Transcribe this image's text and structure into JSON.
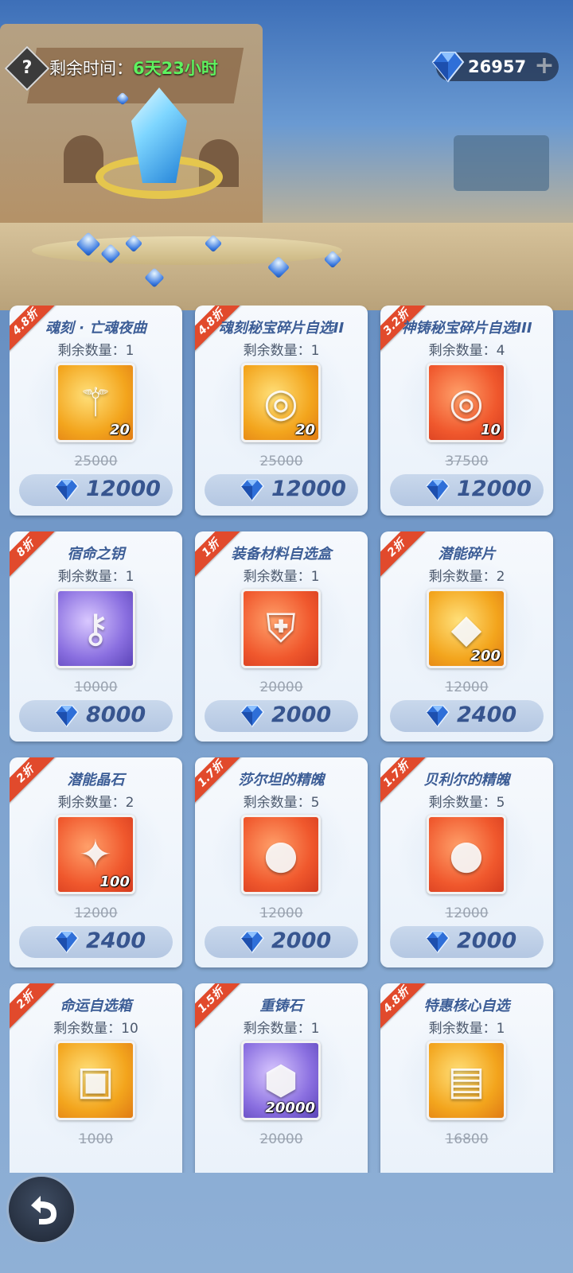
{
  "header": {
    "help_symbol": "?",
    "time_label": "剩余时间：",
    "time_value": "6天23小时",
    "currency_amount": "26957",
    "currency_plus": "+",
    "currency_icon": "diamond-icon"
  },
  "items": [
    {
      "discount": "4.8折",
      "name": "魂刻 · 亡魂夜曲",
      "remaining": "剩余数量：1",
      "icon": "scepter-icon",
      "quality": "orange",
      "count": "20",
      "original": "25000",
      "price": "12000"
    },
    {
      "discount": "4.8折",
      "name": "魂刻秘宝碎片自选II",
      "remaining": "剩余数量：1",
      "icon": "treasure-pedestal-icon",
      "quality": "orange",
      "count": "20",
      "original": "25000",
      "price": "12000"
    },
    {
      "discount": "3.2折",
      "name": "神铸秘宝碎片自选III",
      "remaining": "剩余数量：4",
      "icon": "treasure-pedestal-icon",
      "quality": "red",
      "count": "10",
      "original": "37500",
      "price": "12000"
    },
    {
      "discount": "8折",
      "name": "宿命之钥",
      "remaining": "剩余数量：1",
      "icon": "key-icon",
      "quality": "purple",
      "count": "",
      "original": "10000",
      "price": "8000"
    },
    {
      "discount": "1折",
      "name": "装备材料自选盒",
      "remaining": "剩余数量：1",
      "icon": "armor-icon",
      "quality": "red",
      "count": "",
      "original": "20000",
      "price": "2000"
    },
    {
      "discount": "2折",
      "name": "潜能碎片",
      "remaining": "剩余数量：2",
      "icon": "crystal-shard-icon",
      "quality": "orange",
      "count": "200",
      "original": "12000",
      "price": "2400"
    },
    {
      "discount": "2折",
      "name": "潜能晶石",
      "remaining": "剩余数量：2",
      "icon": "star-crystal-icon",
      "quality": "red",
      "count": "100",
      "original": "12000",
      "price": "2400"
    },
    {
      "discount": "1.7折",
      "name": "莎尔坦的精魄",
      "remaining": "剩余数量：5",
      "icon": "dark-orb-icon",
      "quality": "red",
      "count": "",
      "original": "12000",
      "price": "2000"
    },
    {
      "discount": "1.7折",
      "name": "贝利尔的精魄",
      "remaining": "剩余数量：5",
      "icon": "red-orb-icon",
      "quality": "red",
      "count": "",
      "original": "12000",
      "price": "2000"
    },
    {
      "discount": "2折",
      "name": "命运自选箱",
      "remaining": "剩余数量：10",
      "icon": "chest-icon",
      "quality": "orange",
      "count": "",
      "original": "1000",
      "price": ""
    },
    {
      "discount": "1.5折",
      "name": "重铸石",
      "remaining": "剩余数量：1",
      "icon": "reforge-stone-icon",
      "quality": "purple",
      "count": "20000",
      "original": "20000",
      "price": ""
    },
    {
      "discount": "4.8折",
      "name": "特惠核心自选",
      "remaining": "剩余数量：1",
      "icon": "core-card-icon",
      "quality": "orange",
      "count": "",
      "original": "16800",
      "price": ""
    }
  ],
  "footer": {
    "back_icon": "back-arrow-icon"
  }
}
